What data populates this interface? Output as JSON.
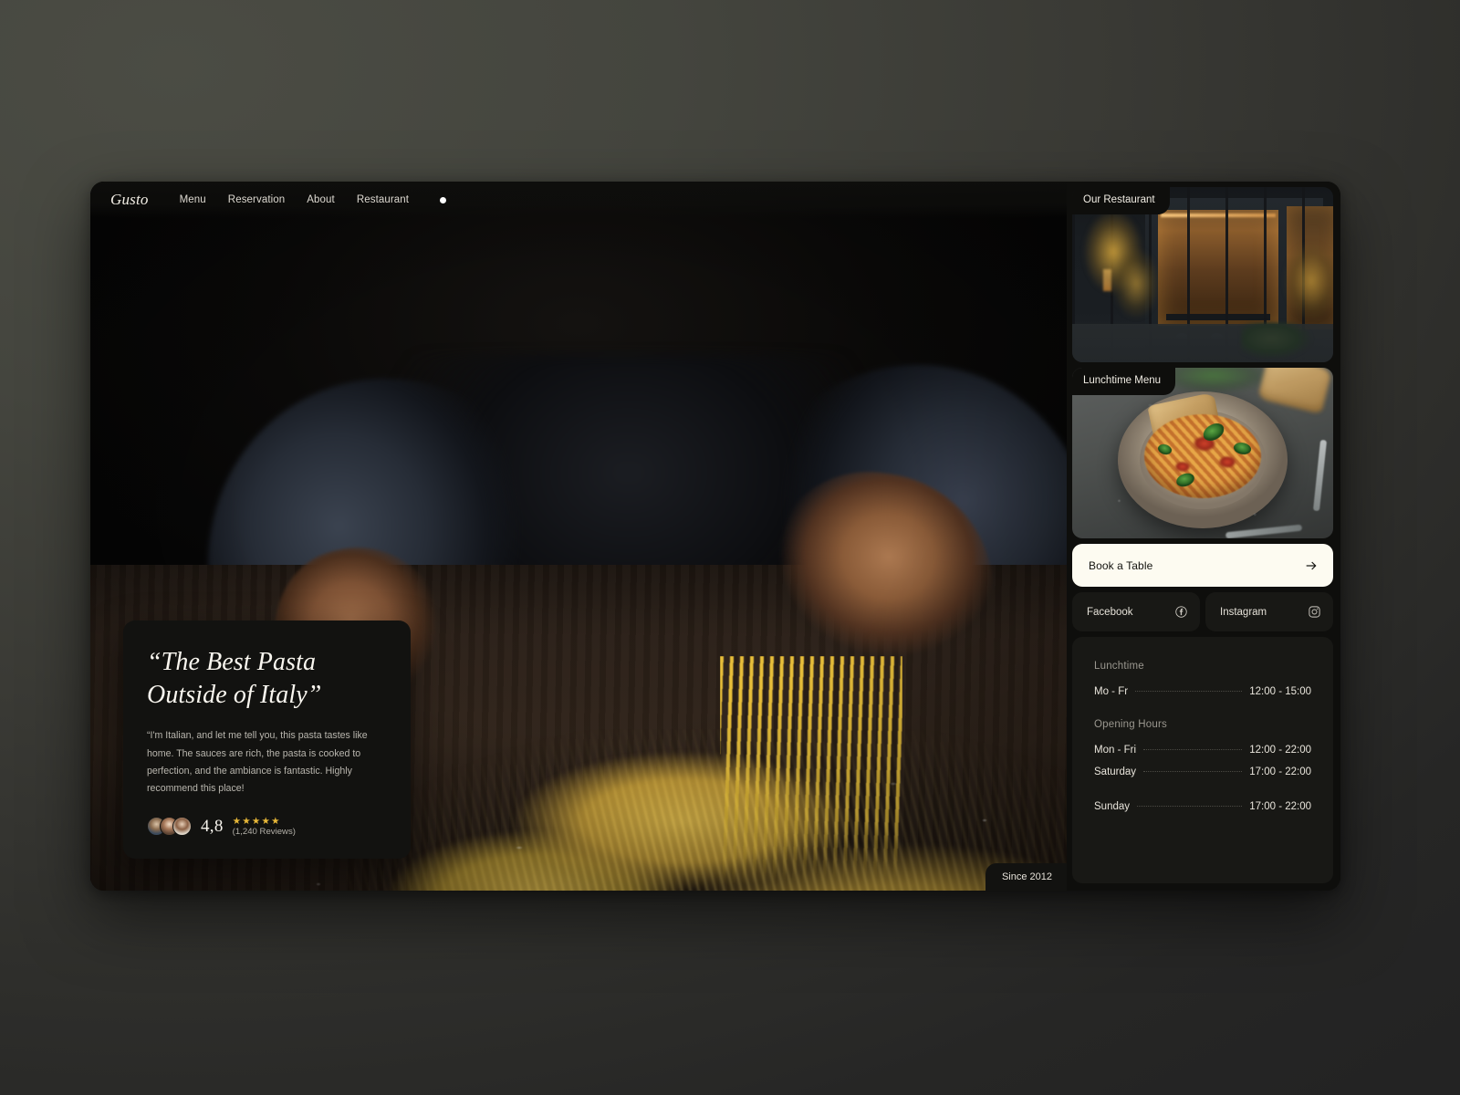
{
  "nav": {
    "logo": "Gusto",
    "links": [
      {
        "label": "Menu"
      },
      {
        "label": "Reservation"
      },
      {
        "label": "About"
      },
      {
        "label": "Restaurant"
      }
    ],
    "indicator_icon": "dot-icon"
  },
  "hero": {
    "since_badge": "Since 2012",
    "image_alt": "chef-hands-fresh-pasta"
  },
  "testimonial": {
    "quote": "“The Best Pasta Outside of Italy”",
    "body": "“I'm Italian, and let me tell you, this pasta tastes like home. The sauces are rich, the pasta is cooked to perfection, and the ambiance is fantastic. Highly recommend this place!",
    "score": "4,8",
    "stars": "★★★★★",
    "stars_count": 5,
    "reviews": "(1,240 Reviews)",
    "avatar_count": 3
  },
  "sidebar": {
    "cards": [
      {
        "label": "Our Restaurant",
        "image_alt": "restaurant-exterior-night"
      },
      {
        "label": "Lunchtime Menu",
        "image_alt": "pasta-plate-with-bread"
      }
    ],
    "book": {
      "label": "Book a Table",
      "icon": "arrow-right-icon"
    },
    "socials": [
      {
        "label": "Facebook",
        "icon": "facebook-icon"
      },
      {
        "label": "Instagram",
        "icon": "instagram-icon"
      }
    ],
    "hours": {
      "lunch_title": "Lunchtime",
      "lunch_rows": [
        {
          "day": "Mo - Fr",
          "time": "12:00 - 15:00"
        }
      ],
      "opening_title": "Opening Hours",
      "opening_rows": [
        {
          "day": "Mon - Fri",
          "time": "12:00 - 22:00"
        },
        {
          "day": "Saturday",
          "time": "17:00 - 22:00"
        },
        {
          "day": "Sunday",
          "time": "17:00 - 22:00"
        }
      ]
    }
  },
  "colors": {
    "page_bg": "#45463f",
    "frame_bg": "#0e0e0c",
    "card_bg": "#181815",
    "cream": "#fdfbf1",
    "star_gold": "#e8b838",
    "text_primary": "#e9e5dc",
    "text_muted": "#9a978f"
  }
}
